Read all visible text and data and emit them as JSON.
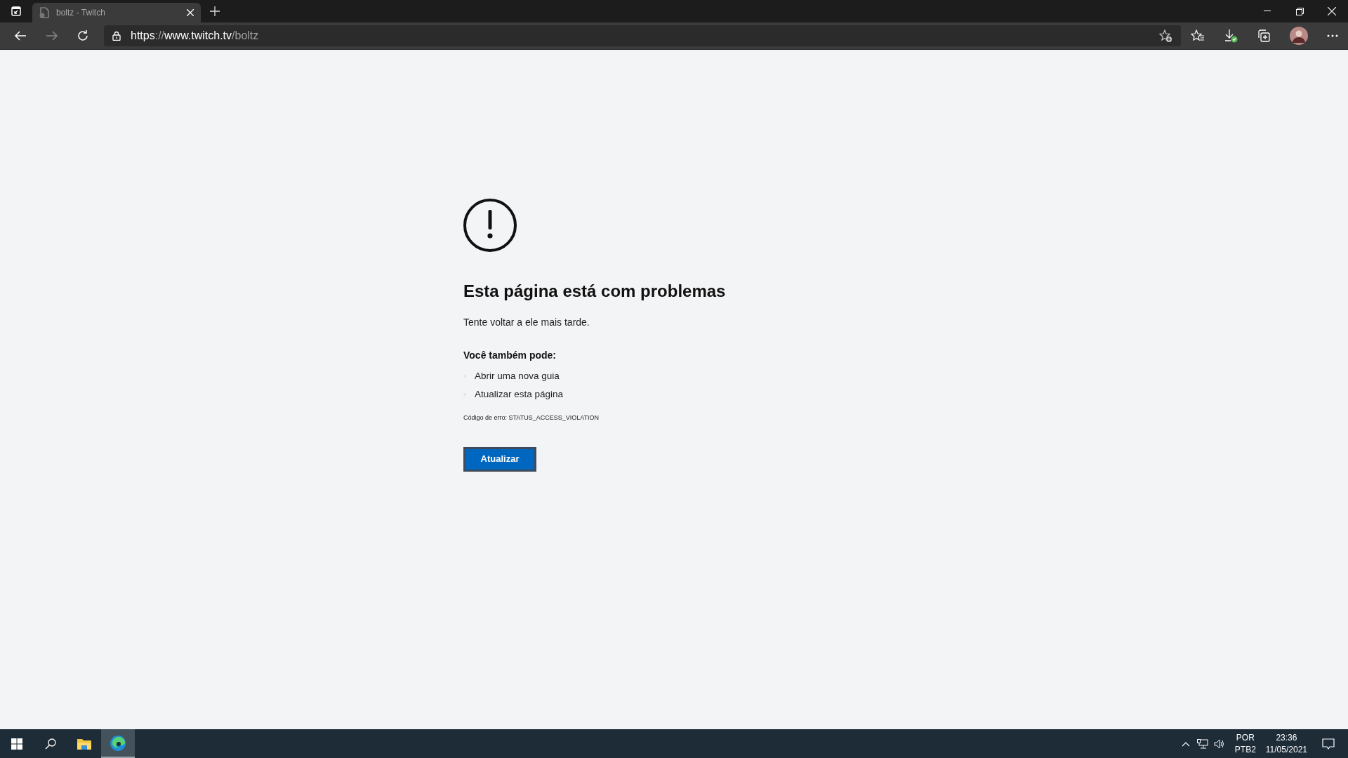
{
  "browser": {
    "tabs": [
      {
        "title": "boltz - Twitch",
        "selected": true
      }
    ],
    "address_bar": {
      "url_parts": [
        {
          "text": "https",
          "dim": false
        },
        {
          "text": "://",
          "dim": true
        },
        {
          "text": "www.twitch.tv",
          "dim": false
        },
        {
          "text": "/boltz",
          "dim": true
        }
      ]
    }
  },
  "error_page": {
    "heading": "Esta página está com problemas",
    "message": "Tente voltar a ele mais tarde.",
    "options_title": "Você também pode:",
    "options": [
      "Abrir uma nova guia",
      "Atualizar esta página"
    ],
    "error_code": "Código de erro: STATUS_ACCESS_VIOLATION",
    "button": "Atualizar"
  },
  "taskbar": {
    "apps": [
      {
        "kind": "files",
        "selected": false
      },
      {
        "kind": "edge",
        "selected": true
      }
    ],
    "language": "POR",
    "keyboard": "PTB2",
    "time": "23:36",
    "date": "11/05/2021"
  }
}
